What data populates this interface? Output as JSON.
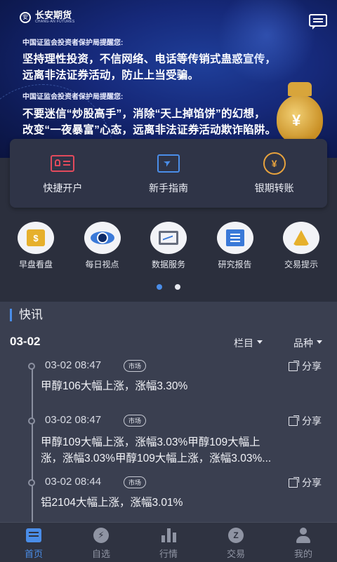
{
  "banner": {
    "logo_name": "长安期货",
    "logo_sub": "CHANG-AN FUTURES",
    "notice_1_head": "中国证监会投资者保护局提醒您:",
    "notice_1_line1": "坚持理性投资，不信网络、电话等传销式蛊惑宣传，",
    "notice_1_line2": "远离非法证券活动，防止上当受骗。",
    "notice_2_head": "中国证监会投资者保护局提醒您:",
    "notice_2_line1": "不要迷信“炒股高手”，消除“天上掉馅饼”的幻想，",
    "notice_2_line2": "改变“一夜暴富”心态，远离非法证券活动欺诈陷阱。",
    "bag_symbol": "¥"
  },
  "quick_actions": [
    {
      "label": "快捷开户",
      "icon": "id-card-icon"
    },
    {
      "label": "新手指南",
      "icon": "guide-book-icon"
    },
    {
      "label": "银期转账",
      "icon": "bank-transfer-icon"
    }
  ],
  "services": [
    {
      "label": "早盘看盘",
      "icon": "calendar-dollar-icon",
      "glyph": "$"
    },
    {
      "label": "每日视点",
      "icon": "eye-icon"
    },
    {
      "label": "数据服务",
      "icon": "monitor-chart-icon"
    },
    {
      "label": "研究报告",
      "icon": "report-icon"
    },
    {
      "label": "交易提示",
      "icon": "bell-icon"
    }
  ],
  "carousel": {
    "pages": 2,
    "active": 0
  },
  "news": {
    "title": "快讯",
    "date": "03-02",
    "filter_column": "栏目",
    "filter_variety": "品种",
    "share_label": "分享",
    "entries": [
      {
        "time": "03-02 08:47",
        "tag": "市场",
        "line1": "甲醇106大幅上涨，涨幅3.30%",
        "line2": ""
      },
      {
        "time": "03-02 08:47",
        "tag": "市场",
        "line1": "甲醇109大幅上涨，涨幅3.03%甲醇109大幅上",
        "line2": "涨，涨幅3.03%甲醇109大幅上涨，涨幅3.03%..."
      },
      {
        "time": "03-02 08:44",
        "tag": "市场",
        "line1": "铝2104大幅上涨，涨幅3.01%",
        "line2": ""
      }
    ]
  },
  "tabs": [
    {
      "label": "首页",
      "active": true
    },
    {
      "label": "自选",
      "glyph": "⚡"
    },
    {
      "label": "行情"
    },
    {
      "label": "交易",
      "glyph": "Z"
    },
    {
      "label": "我的"
    }
  ],
  "colors": {
    "accent": "#4a8de8",
    "banner": "#16297a",
    "background": "#2b2f3d"
  }
}
